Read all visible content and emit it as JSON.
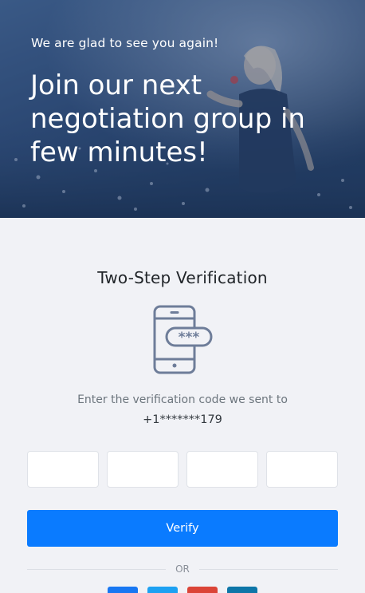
{
  "hero": {
    "subtitle": "We are glad to see you again!",
    "title": "Join our next negotiation group in few minutes!"
  },
  "verification": {
    "title": "Two-Step Verification",
    "icon": "phone-password-icon",
    "description": "Enter the verification code we sent to",
    "phone": "+1*******179",
    "code_inputs": [
      "",
      "",
      "",
      ""
    ],
    "verify_label": "Verify",
    "or_label": "OR"
  },
  "social": [
    {
      "name": "facebook",
      "color": "#1877f2"
    },
    {
      "name": "twitter",
      "color": "#1da1f2"
    },
    {
      "name": "google",
      "color": "#db4437"
    },
    {
      "name": "linkedin",
      "color": "#0e76a8"
    }
  ],
  "colors": {
    "accent": "#0a7bff",
    "background": "#f1f2f6",
    "icon": "#6e7d99"
  }
}
